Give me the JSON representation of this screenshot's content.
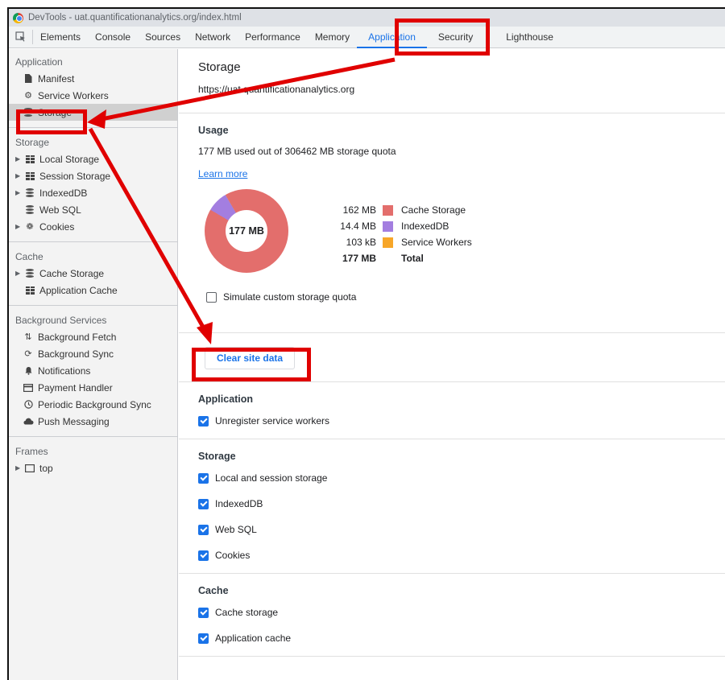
{
  "window": {
    "title": "DevTools - uat.quantificationanalytics.org/index.html"
  },
  "tabs": [
    {
      "label": "Elements"
    },
    {
      "label": "Console"
    },
    {
      "label": "Sources"
    },
    {
      "label": "Network"
    },
    {
      "label": "Performance"
    },
    {
      "label": "Memory"
    },
    {
      "label": "Application"
    },
    {
      "label": "Security"
    },
    {
      "label": "Lighthouse"
    }
  ],
  "sidebar": {
    "application": {
      "heading": "Application",
      "items": [
        {
          "label": "Manifest"
        },
        {
          "label": "Service Workers"
        },
        {
          "label": "Storage"
        }
      ]
    },
    "storage": {
      "heading": "Storage",
      "items": [
        {
          "label": "Local Storage"
        },
        {
          "label": "Session Storage"
        },
        {
          "label": "IndexedDB"
        },
        {
          "label": "Web SQL"
        },
        {
          "label": "Cookies"
        }
      ]
    },
    "cache": {
      "heading": "Cache",
      "items": [
        {
          "label": "Cache Storage"
        },
        {
          "label": "Application Cache"
        }
      ]
    },
    "background": {
      "heading": "Background Services",
      "items": [
        {
          "label": "Background Fetch"
        },
        {
          "label": "Background Sync"
        },
        {
          "label": "Notifications"
        },
        {
          "label": "Payment Handler"
        },
        {
          "label": "Periodic Background Sync"
        },
        {
          "label": "Push Messaging"
        }
      ]
    },
    "frames": {
      "heading": "Frames",
      "items": [
        {
          "label": "top"
        }
      ]
    }
  },
  "main": {
    "title": "Storage",
    "url": "https://uat.quantificationanalytics.org",
    "usage": {
      "heading": "Usage",
      "summary": "177 MB used out of 306462 MB storage quota",
      "learn_more": "Learn more",
      "donut_label": "177 MB",
      "legend": [
        {
          "value": "162 MB",
          "label": "Cache Storage",
          "color": "#e36e6c"
        },
        {
          "value": "14.4 MB",
          "label": "IndexedDB",
          "color": "#a37ee0"
        },
        {
          "value": "103 kB",
          "label": "Service Workers",
          "color": "#f7a628"
        }
      ],
      "total": {
        "value": "177 MB",
        "label": "Total"
      },
      "simulate_label": "Simulate custom storage quota"
    },
    "clear_button": "Clear site data",
    "application_section": {
      "heading": "Application",
      "options": [
        {
          "label": "Unregister service workers",
          "checked": true
        }
      ]
    },
    "storage_section": {
      "heading": "Storage",
      "options": [
        {
          "label": "Local and session storage",
          "checked": true
        },
        {
          "label": "IndexedDB",
          "checked": true
        },
        {
          "label": "Web SQL",
          "checked": true
        },
        {
          "label": "Cookies",
          "checked": true
        }
      ]
    },
    "cache_section": {
      "heading": "Cache",
      "options": [
        {
          "label": "Cache storage",
          "checked": true
        },
        {
          "label": "Application cache",
          "checked": true
        }
      ]
    }
  },
  "colors": {
    "accent": "#1a73e8",
    "annotation": "#e00000"
  }
}
